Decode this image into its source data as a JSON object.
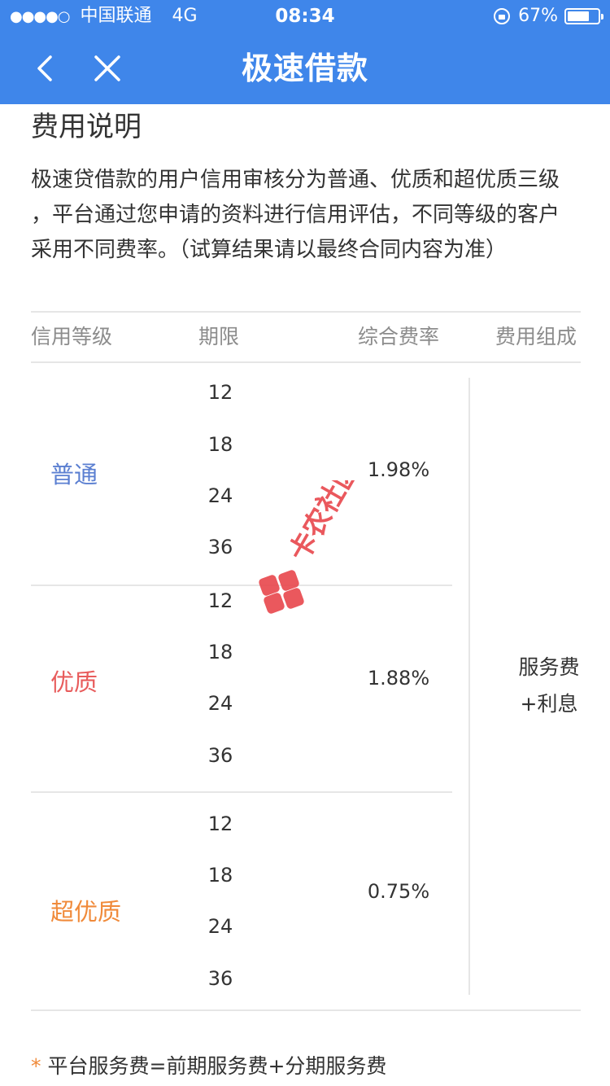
{
  "status_bar": {
    "signal": "●●●●○",
    "carrier": "中国联通",
    "network": "4G",
    "time": "08:34",
    "battery": "67%",
    "battery_level": 0.67
  },
  "nav": {
    "title": "极速借款",
    "back_icon": "chevron-left-icon",
    "close_icon": "close-icon"
  },
  "section": {
    "title": "费用说明",
    "description_lines": [
      "极速贷借款的用户信用审核分为普通、优质和超优质三级",
      "，平台通过您申请的资料进行信用评估，不同等级的客户",
      "采用不同费率。（试算结果请以最终合同内容为准）"
    ]
  },
  "table": {
    "headers": [
      "信用等级",
      "期限",
      "综合费率",
      "费用组成"
    ],
    "rows": [
      {
        "grade": "普通",
        "grade_color": "#5b7fd1",
        "terms": [
          "12",
          "18",
          "24",
          "36"
        ],
        "rate": "1.98%"
      },
      {
        "grade": "优质",
        "grade_color": "#e85c5c",
        "terms": [
          "12",
          "18",
          "24",
          "36"
        ],
        "rate": "1.88%"
      },
      {
        "grade": "超优质",
        "grade_color": "#f08a3a",
        "terms": [
          "12",
          "18",
          "24",
          "36"
        ],
        "rate": "0.75%"
      }
    ],
    "composition_lines": [
      "服务费",
      "+利息"
    ]
  },
  "footnote": {
    "star": "*",
    "text": "平台服务费=前期服务费+分期服务费"
  },
  "watermark": {
    "text": "卡农社区",
    "color": "#e8474c"
  },
  "colors": {
    "header_bg": "#3f86ea",
    "divider": "#e6e6e6"
  }
}
